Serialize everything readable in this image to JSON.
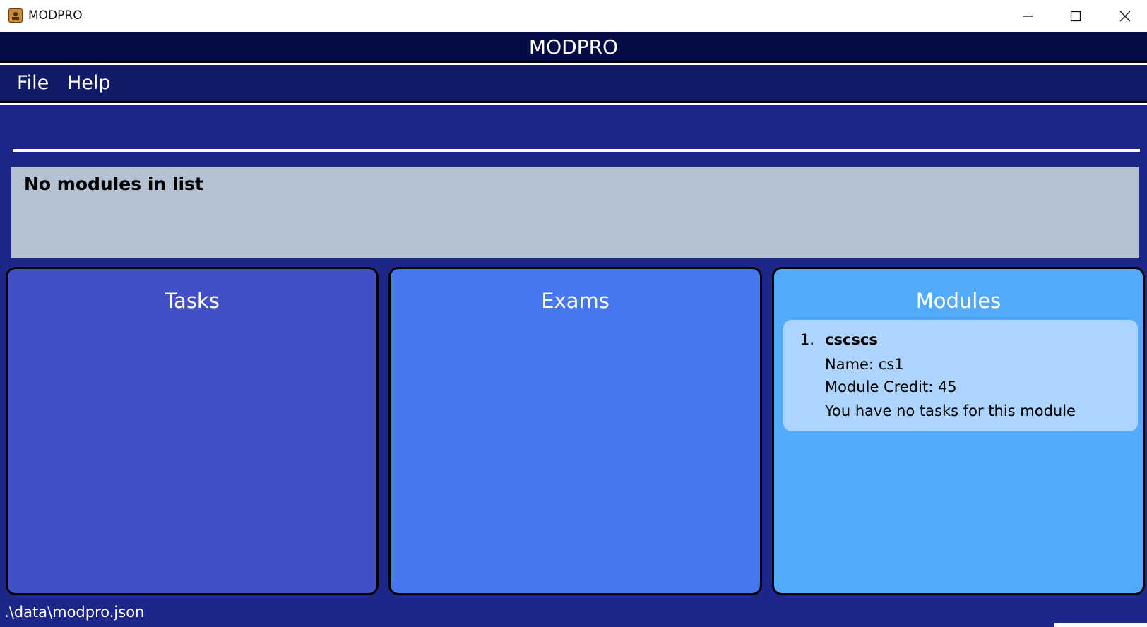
{
  "window": {
    "title": "MODPRO",
    "app_icon": "app-icon",
    "controls": [
      "minimize-icon",
      "maximize-icon",
      "close-icon"
    ]
  },
  "header": {
    "title": "MODPRO"
  },
  "menu": {
    "file": "File",
    "help": "Help"
  },
  "result": {
    "message": "No modules in list"
  },
  "panels": {
    "tasks": {
      "title": "Tasks",
      "color": "#4150c4"
    },
    "exams": {
      "title": "Exams",
      "color": "#4677f0"
    },
    "modules": {
      "title": "Modules",
      "color": "#53a9fa",
      "items": [
        {
          "index": "1.",
          "code": "cscscs",
          "name": "Name: cs1",
          "credit": "Module Credit: 45",
          "tasks": "You have no tasks for this module"
        }
      ]
    }
  },
  "status": {
    "path": ".\\data\\modpro.json"
  },
  "colors": {
    "header_bg": "#050c45",
    "menubar_bg": "#121a68",
    "main_bg": "#1d2789",
    "result_bg": "#b3c1d1",
    "module_card_bg": "#add4fc"
  }
}
